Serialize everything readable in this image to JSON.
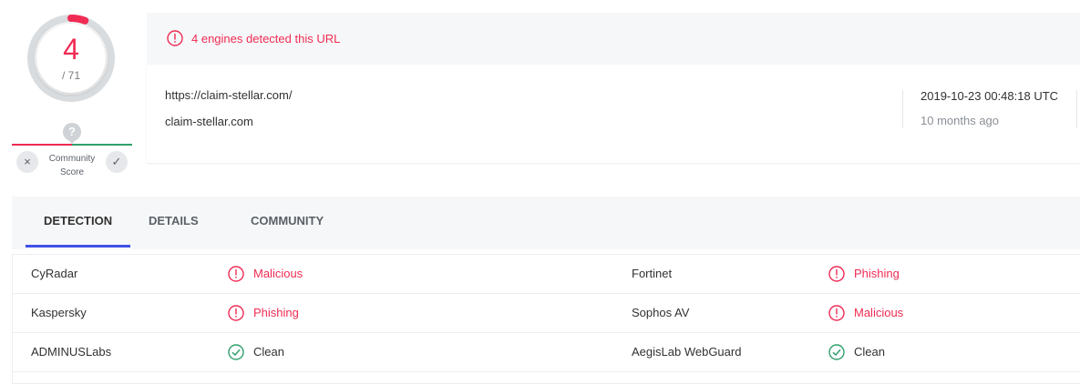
{
  "score": {
    "detections": "4",
    "total": "/ 71",
    "colors": {
      "malicious": "#f02b54",
      "ring": "#d9dcdf"
    }
  },
  "community": {
    "unknown_icon": "?",
    "downvote_icon": "×",
    "upvote_icon": "✓",
    "label_line1": "Community",
    "label_line2": "Score"
  },
  "header": {
    "alert_icon": "alert-circle-icon",
    "alert_text": "4 engines detected this URL",
    "url": "https://claim-stellar.com/",
    "domain": "claim-stellar.com",
    "analysis_date": "2019-10-23 00:48:18 UTC",
    "relative_time": "10 months ago"
  },
  "tabs": [
    {
      "label": "DETECTION",
      "active": true
    },
    {
      "label": "DETAILS",
      "active": false
    },
    {
      "label": "COMMUNITY",
      "active": false
    }
  ],
  "results": [
    {
      "left": {
        "engine": "CyRadar",
        "verdict": "Malicious",
        "status": "malicious"
      },
      "right": {
        "engine": "Fortinet",
        "verdict": "Phishing",
        "status": "malicious"
      }
    },
    {
      "left": {
        "engine": "Kaspersky",
        "verdict": "Phishing",
        "status": "malicious"
      },
      "right": {
        "engine": "Sophos AV",
        "verdict": "Malicious",
        "status": "malicious"
      }
    },
    {
      "left": {
        "engine": "ADMINUSLabs",
        "verdict": "Clean",
        "status": "clean"
      },
      "right": {
        "engine": "AegisLab WebGuard",
        "verdict": "Clean",
        "status": "clean"
      }
    }
  ]
}
